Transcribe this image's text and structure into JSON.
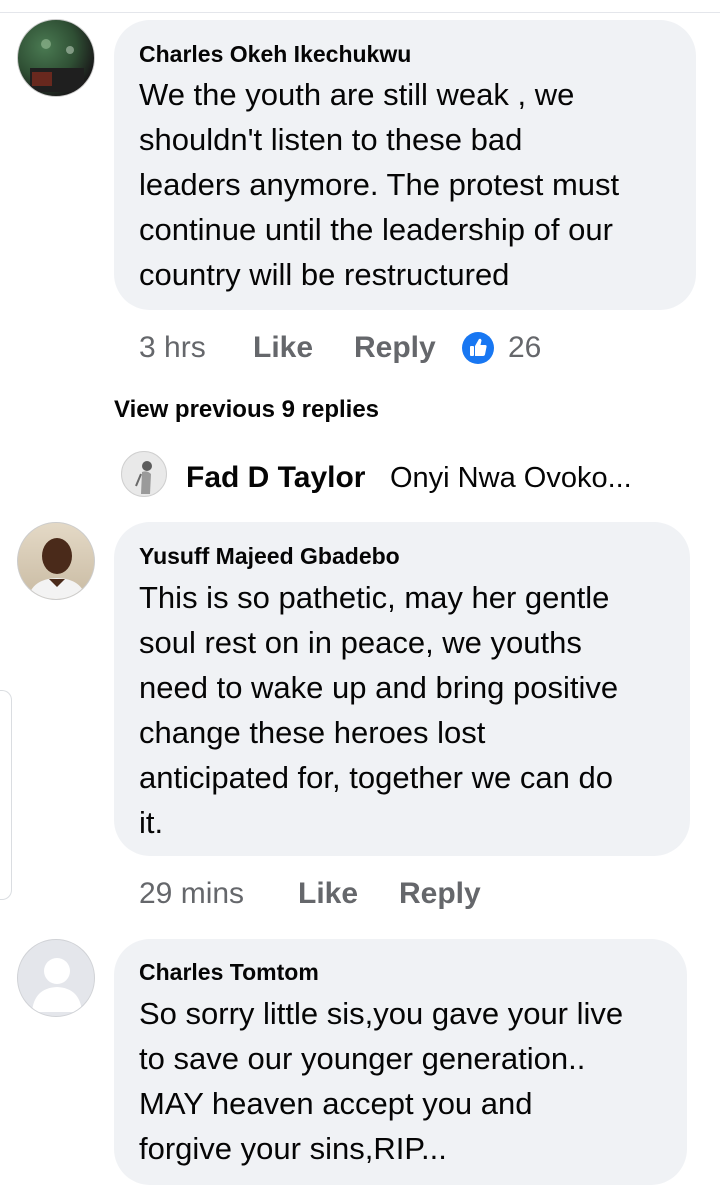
{
  "comments": [
    {
      "author": "Charles Okeh Ikechukwu",
      "lines": [
        "We the youth are still weak ,  we",
        "shouldn't listen to these bad",
        "leaders anymore. The protest must",
        "continue until the leadership of our",
        "country will be restructured"
      ],
      "time": "3 hrs",
      "like_label": "Like",
      "reply_label": "Reply",
      "reaction_count": "26",
      "reaction_icon": "thumbs-up-icon"
    },
    {
      "author": "Yusuff Majeed Gbadebo",
      "lines": [
        "This is so pathetic, may her gentle",
        "soul rest on in peace, we youths",
        "need to wake up and bring positive",
        "change these heroes lost",
        "anticipated for, together we can do",
        "it."
      ],
      "time": "29 mins",
      "like_label": "Like",
      "reply_label": "Reply"
    },
    {
      "author": "Charles Tomtom",
      "lines": [
        "So sorry little sis,you gave your live",
        "to save our younger generation..",
        "MAY heaven accept you and",
        "forgive your sins,RIP..."
      ]
    }
  ],
  "view_previous": "View previous 9 replies",
  "reply_preview": {
    "name": "Fad D Taylor",
    "snippet": "Onyi Nwa Ovoko..."
  },
  "colors": {
    "bubble": "#f0f2f5",
    "meta_text": "#65676b",
    "like_blue": "#1877f2"
  }
}
